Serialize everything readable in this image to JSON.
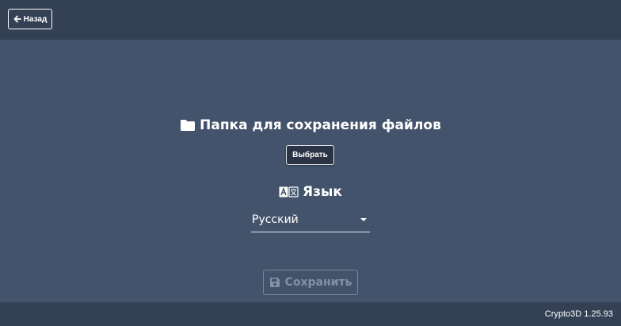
{
  "header": {
    "back_label": "Назад",
    "back_icon": "arrow-left-icon"
  },
  "main": {
    "folder_section": {
      "title": "Папка для сохранения файлов",
      "icon": "folder-icon",
      "choose_label": "Выбрать"
    },
    "language_section": {
      "title": "Язык",
      "icon": "translate-icon",
      "selected_language": "Русский"
    },
    "save_button": {
      "label": "Сохранить",
      "icon": "floppy-disk-icon",
      "disabled": true
    }
  },
  "footer": {
    "version": "Crypto3D 1.25.93"
  },
  "colors": {
    "background": "#43536c",
    "bars": "#344155",
    "text": "#ffffff",
    "disabled_text": "#8590a2"
  }
}
